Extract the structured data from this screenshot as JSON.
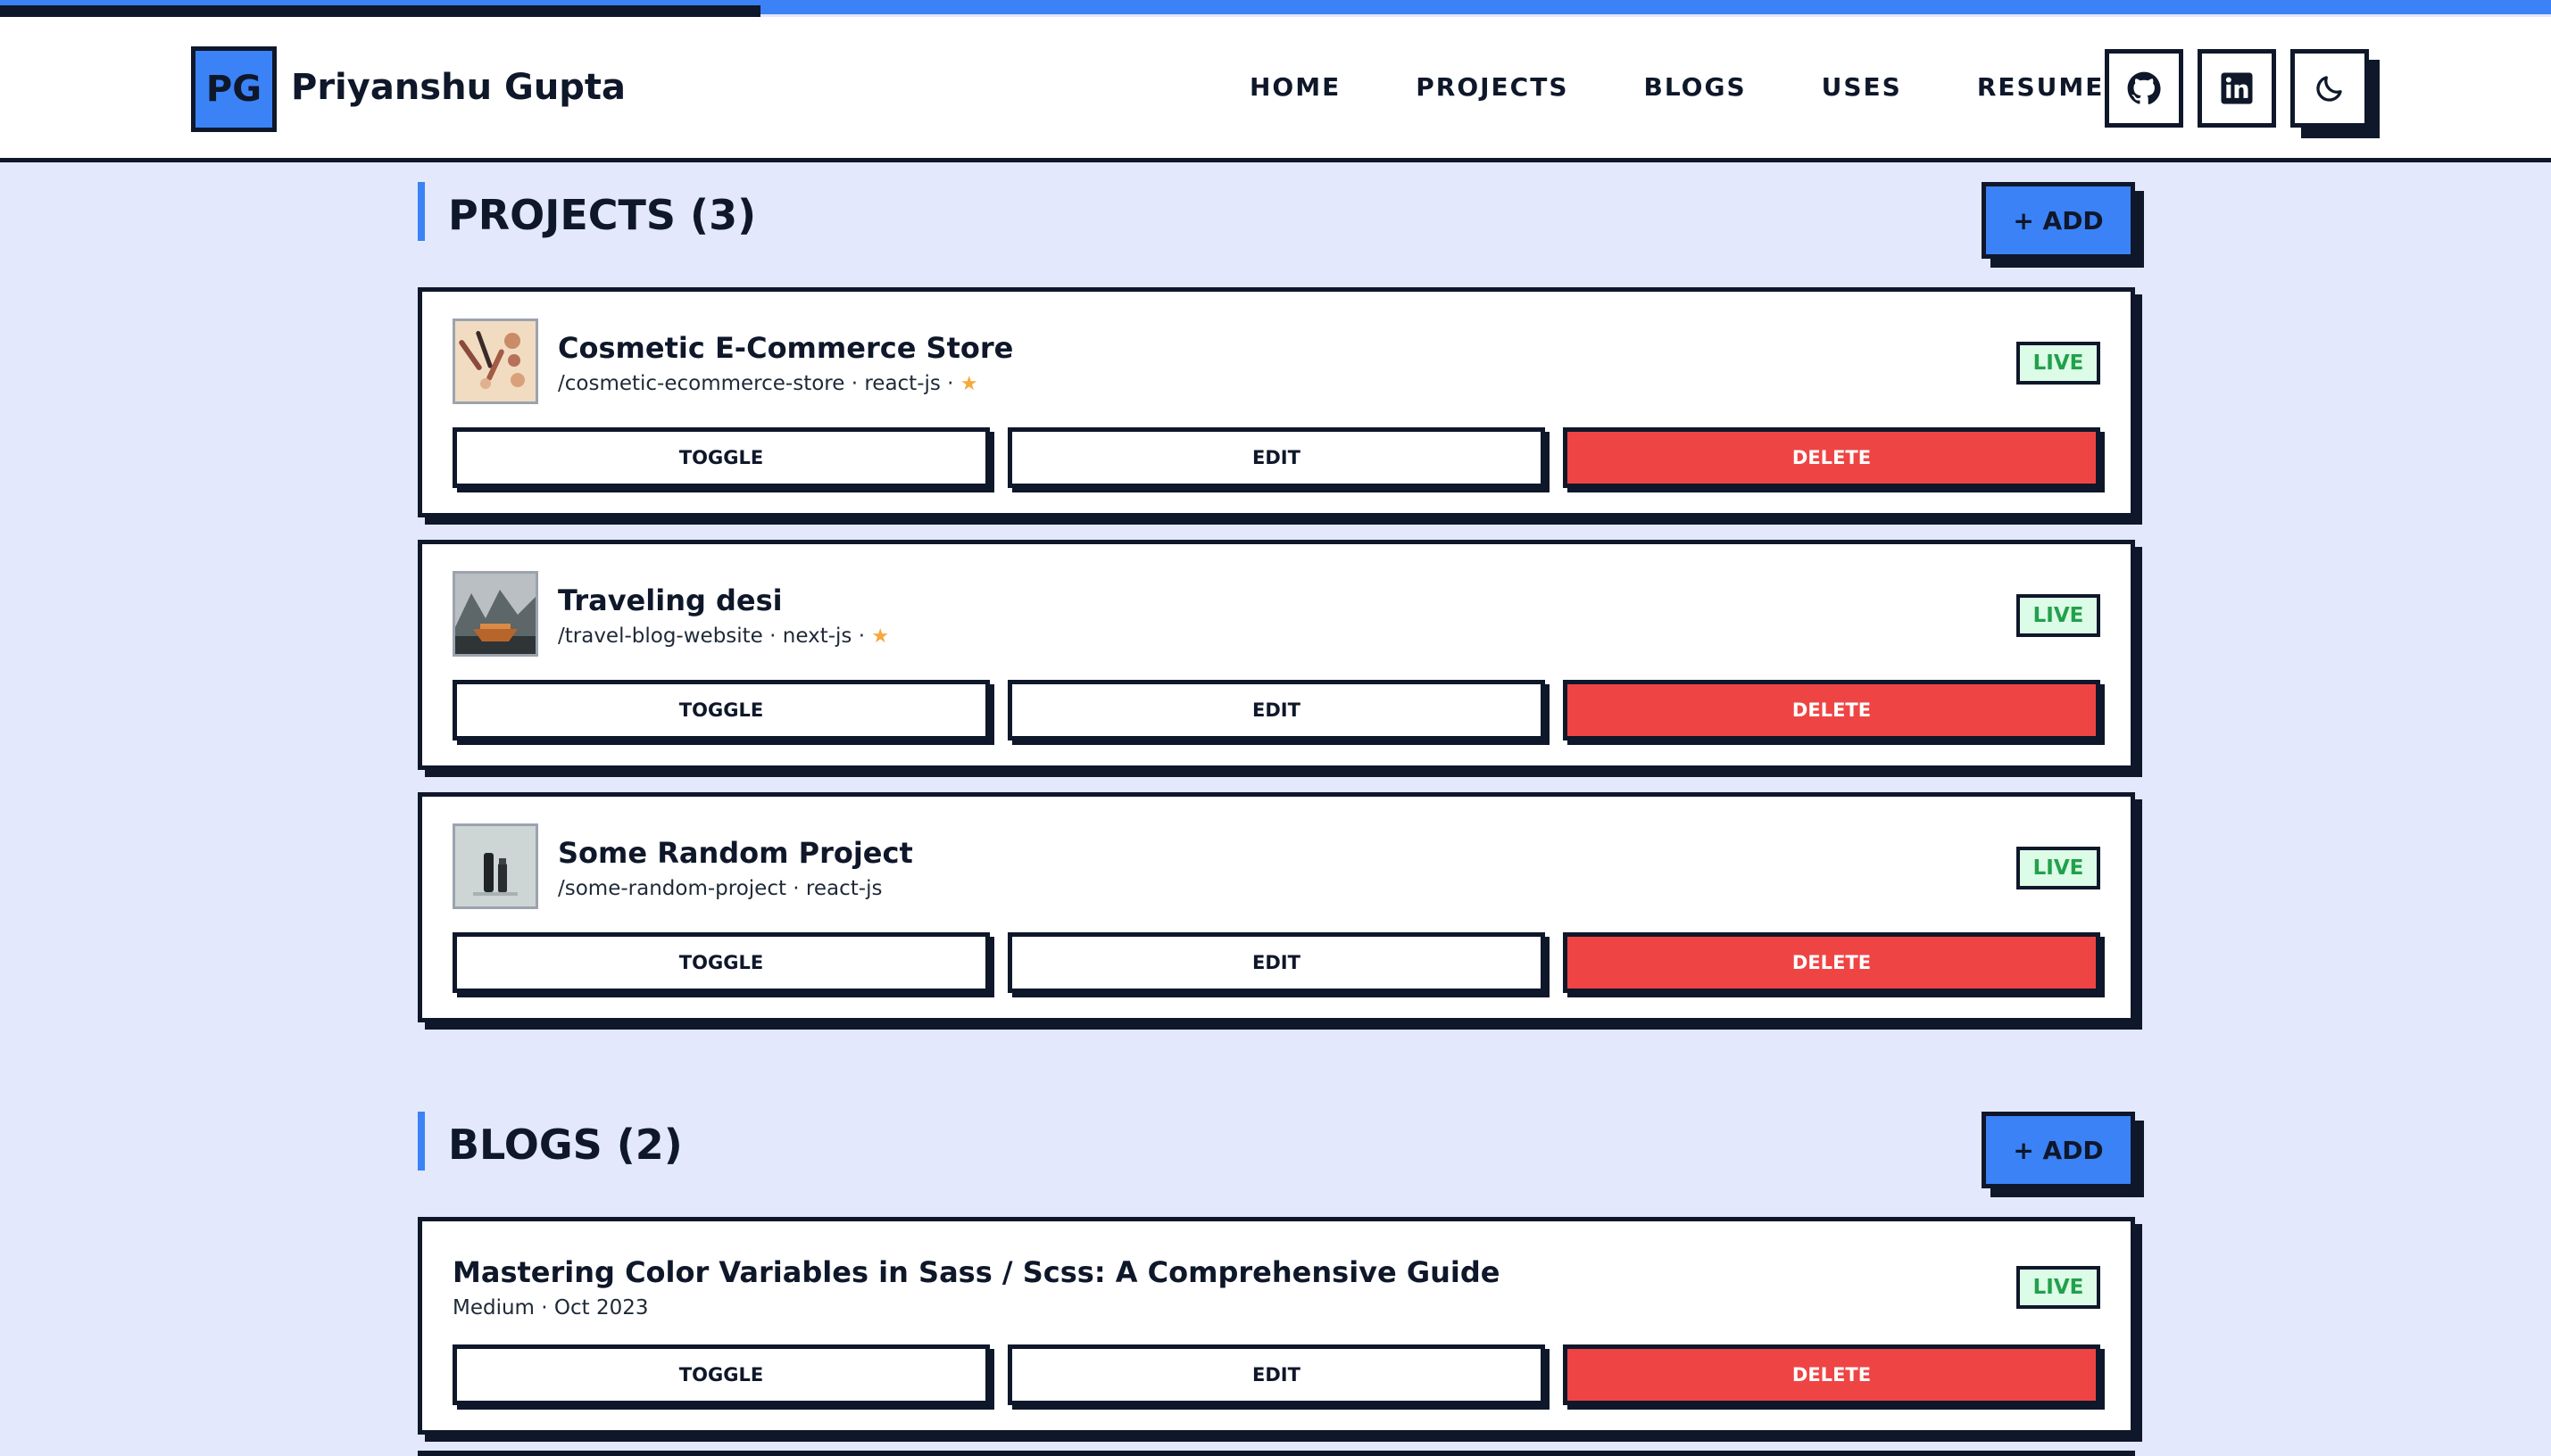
{
  "header": {
    "logo_initials": "PG",
    "site_name": "Priyanshu Gupta",
    "nav": [
      "HOME",
      "PROJECTS",
      "BLOGS",
      "USES",
      "RESUME"
    ],
    "icons": [
      "github-icon",
      "linkedin-icon",
      "moon-icon"
    ]
  },
  "colors": {
    "accent": "#3b82f6",
    "dark": "#0f172a",
    "danger": "#ef4444",
    "live_bg": "#dcfce7",
    "live_text": "#22a04b",
    "page_bg": "#e3e8fc"
  },
  "projects": {
    "title": "PROJECTS (3)",
    "add_label": "+ ADD",
    "items": [
      {
        "title": "Cosmetic E-Commerce Store",
        "meta": "/cosmetic-ecommerce-store · react-js · ",
        "starred": true,
        "status": "LIVE",
        "toggle": "TOGGLE",
        "edit": "EDIT",
        "delete": "DELETE"
      },
      {
        "title": "Traveling desi",
        "meta": "/travel-blog-website · next-js · ",
        "starred": true,
        "status": "LIVE",
        "toggle": "TOGGLE",
        "edit": "EDIT",
        "delete": "DELETE"
      },
      {
        "title": "Some Random Project",
        "meta": "/some-random-project · react-js",
        "starred": false,
        "status": "LIVE",
        "toggle": "TOGGLE",
        "edit": "EDIT",
        "delete": "DELETE"
      }
    ]
  },
  "blogs": {
    "title": "BLOGS (2)",
    "add_label": "+ ADD",
    "items": [
      {
        "title": "Mastering Color Variables in Sass / Scss: A Comprehensive Guide",
        "meta": "Medium · Oct 2023",
        "status": "LIVE",
        "toggle": "TOGGLE",
        "edit": "EDIT",
        "delete": "DELETE"
      }
    ]
  }
}
